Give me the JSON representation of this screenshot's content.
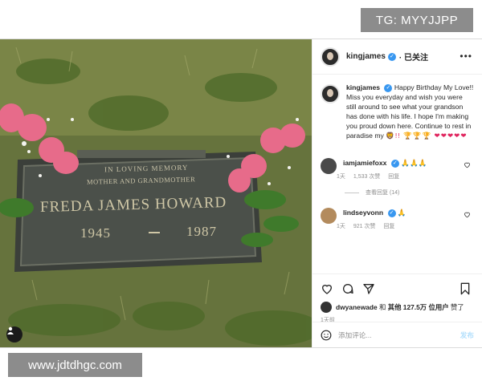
{
  "watermark_top": "TG: MYYJJPP",
  "watermark_bottom": "www.jdtdhgc.com",
  "photo": {
    "plaque_line1": "IN LOVING MEMORY",
    "plaque_line2": "MOTHER AND GRANDMOTHER",
    "plaque_name": "FREDA JAMES HOWARD",
    "plaque_year_start": "1945",
    "plaque_year_end": "1987"
  },
  "header": {
    "username": "kingjames",
    "verified_icon": "verified-badge-icon",
    "follow_label": "· 已关注",
    "more_icon": "more-options-icon"
  },
  "caption": {
    "username": "kingjames",
    "text": "Happy Birthday My Love!! Miss you everyday and wish you were still around to see what your grandson has done with his life. I hope I'm making you proud down here. Continue to rest in paradise my",
    "emoji_tail": "🦁!! 🏆🏆🏆 ❤❤❤❤❤"
  },
  "comments": [
    {
      "username": "iamjamiefoxx",
      "text": "🙏🙏🙏",
      "time": "1天",
      "likes": "1,533 次赞",
      "reply": "回复",
      "view_replies": "查看回复 (14)",
      "avatar_color": "#4a4a4a"
    },
    {
      "username": "lindseyvonn",
      "text": "🙏",
      "time": "1天",
      "likes": "921 次赞",
      "reply": "回复",
      "avatar_color": "#b38b5d"
    }
  ],
  "likes_line": {
    "first_user": "dwyanewade",
    "and": " 和 ",
    "others": "其他 127.5万 位用户",
    "suffix": " 赞了"
  },
  "date": "1天前",
  "add_comment": {
    "placeholder": "添加评论...",
    "post_label": "发布"
  },
  "colors": {
    "accent_blue": "#3897f0",
    "post_disabled": "#b2dffc",
    "heart_red": "#e0245e"
  }
}
